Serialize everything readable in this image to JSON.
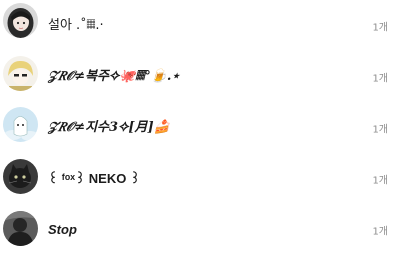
{
  "list": {
    "rows": [
      {
        "name": "설아 .˚𝄜.·",
        "count": "1개",
        "avatar_icon": "girl-black-hair-avatar"
      },
      {
        "name": "𝒵𝑅𝒪≠복주✧🐙𝄜°🍺.⋆",
        "count": "1개",
        "avatar_icon": "blonde-character-avatar"
      },
      {
        "name": "𝒵𝑅𝒪≠지수3✧[月]🍰",
        "count": "1개",
        "avatar_icon": "white-cat-avatar"
      },
      {
        "name": "꒰ ᶠᵒˣ꒱ NEKO ꒱",
        "count": "1개",
        "avatar_icon": "black-cat-avatar"
      },
      {
        "name": "Stop",
        "count": "1개",
        "avatar_icon": "dark-figure-avatar"
      }
    ]
  },
  "colors": {
    "text": "#1c1c1c",
    "count": "#8e8e8e",
    "background": "#ffffff"
  }
}
